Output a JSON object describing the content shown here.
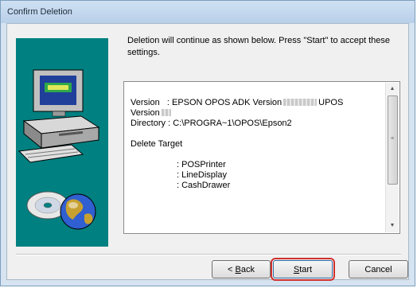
{
  "window": {
    "title": "Confirm Deletion"
  },
  "message": "Deletion will continue as shown below. Press \"Start\" to accept these settings.",
  "summary": {
    "version_label": "Version",
    "version_value_prefix": ": EPSON OPOS ADK Version",
    "version_value_suffix": "UPOS",
    "version_line2": "Version",
    "directory_label": "Directory",
    "directory_value": ": C:\\PROGRA~1\\OPOS\\Epson2",
    "delete_target_label": "Delete Target",
    "targets": [
      ": POSPrinter",
      ": LineDisplay",
      ": CashDrawer"
    ]
  },
  "buttons": {
    "back_prefix": "< ",
    "back_accel": "B",
    "back_rest": "ack",
    "start_accel": "S",
    "start_rest": "tart",
    "cancel": "Cancel"
  },
  "colors": {
    "banner": "#008080",
    "highlight": "#d0312d"
  },
  "icons": [
    "computer-icon",
    "disc-icon",
    "globe-icon",
    "scroll-up-icon",
    "scroll-down-icon"
  ]
}
